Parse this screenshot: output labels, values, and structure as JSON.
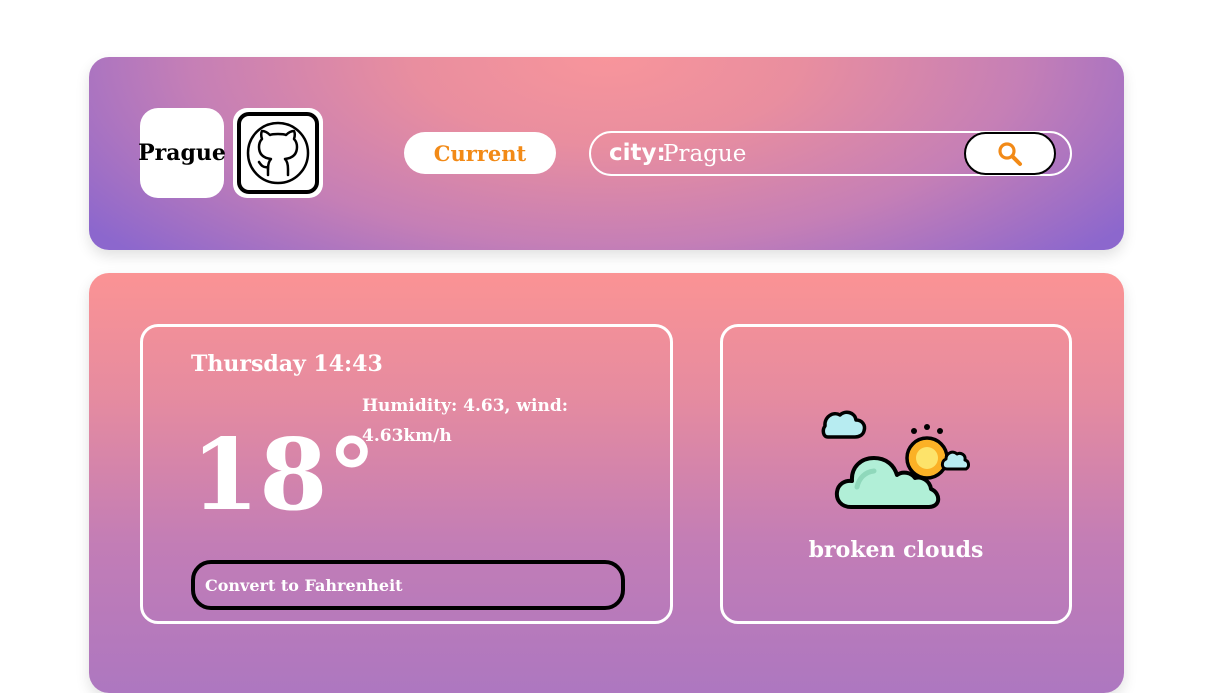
{
  "header": {
    "city_badge": "Prague",
    "github_icon": "github-icon",
    "current_button": "Current",
    "search": {
      "label": "city:",
      "value": "Prague",
      "button_icon": "search-icon"
    }
  },
  "weather": {
    "datetime": "Thursday 14:43",
    "meta": "Humidity: 4.63, wind: 4.63km/h",
    "temperature": "18°",
    "convert_button": "Convert to Fahrenheit",
    "condition_icon": "broken-clouds-icon",
    "description": "broken clouds"
  },
  "colors": {
    "accent_orange": "#f28a17",
    "header_edge_purple": "#8c67cd",
    "header_center_pink": "#f8959b",
    "card_top_pink": "#fb9394",
    "card_bottom_purple": "#ad77c0"
  }
}
